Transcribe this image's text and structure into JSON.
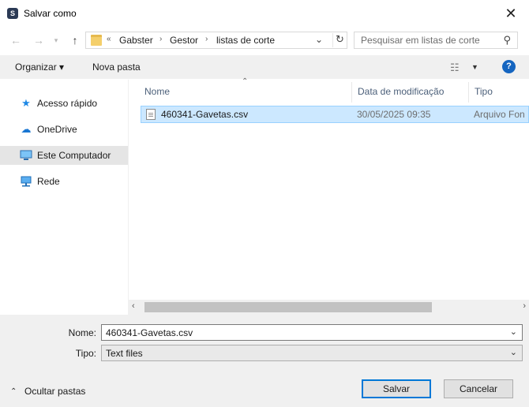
{
  "window": {
    "title": "Salvar como",
    "app_icon_glyph": "S",
    "close_glyph": "✕"
  },
  "address_bar": {
    "overflow_glyph": "«",
    "breadcrumbs": [
      "Gabster",
      "Gestor",
      "listas de corte"
    ],
    "separator_glyph": "›"
  },
  "search": {
    "placeholder": "Pesquisar em listas de corte"
  },
  "toolbar": {
    "organize_label": "Organizar ▾",
    "new_folder_label": "Nova pasta",
    "help_glyph": "?"
  },
  "nav_pane": {
    "items": [
      {
        "label": "Acesso rápido",
        "icon": "star-icon",
        "color": "#1e88e5"
      },
      {
        "label": "OneDrive",
        "icon": "cloud-icon",
        "color": "#1976d2"
      },
      {
        "label": "Este Computador",
        "icon": "computer-icon",
        "color": "#2196f3",
        "selected": true
      },
      {
        "label": "Rede",
        "icon": "network-icon",
        "color": "#1e88e5"
      }
    ]
  },
  "file_list": {
    "columns": [
      "Nome",
      "Data de modificação",
      "Tipo"
    ],
    "rows": [
      {
        "name": "460341-Gavetas.csv",
        "date": "30/05/2025 09:35",
        "type": "Arquivo Fon"
      }
    ]
  },
  "form": {
    "name_label": "Nome:",
    "name_value": "460341-Gavetas.csv",
    "type_label": "Tipo:",
    "type_value": "Text files"
  },
  "footer": {
    "hide_folders_label": "Ocultar pastas",
    "save_label": "Salvar",
    "cancel_label": "Cancelar"
  },
  "colors": {
    "selection": "#cce8ff",
    "accent": "#0078d7"
  }
}
